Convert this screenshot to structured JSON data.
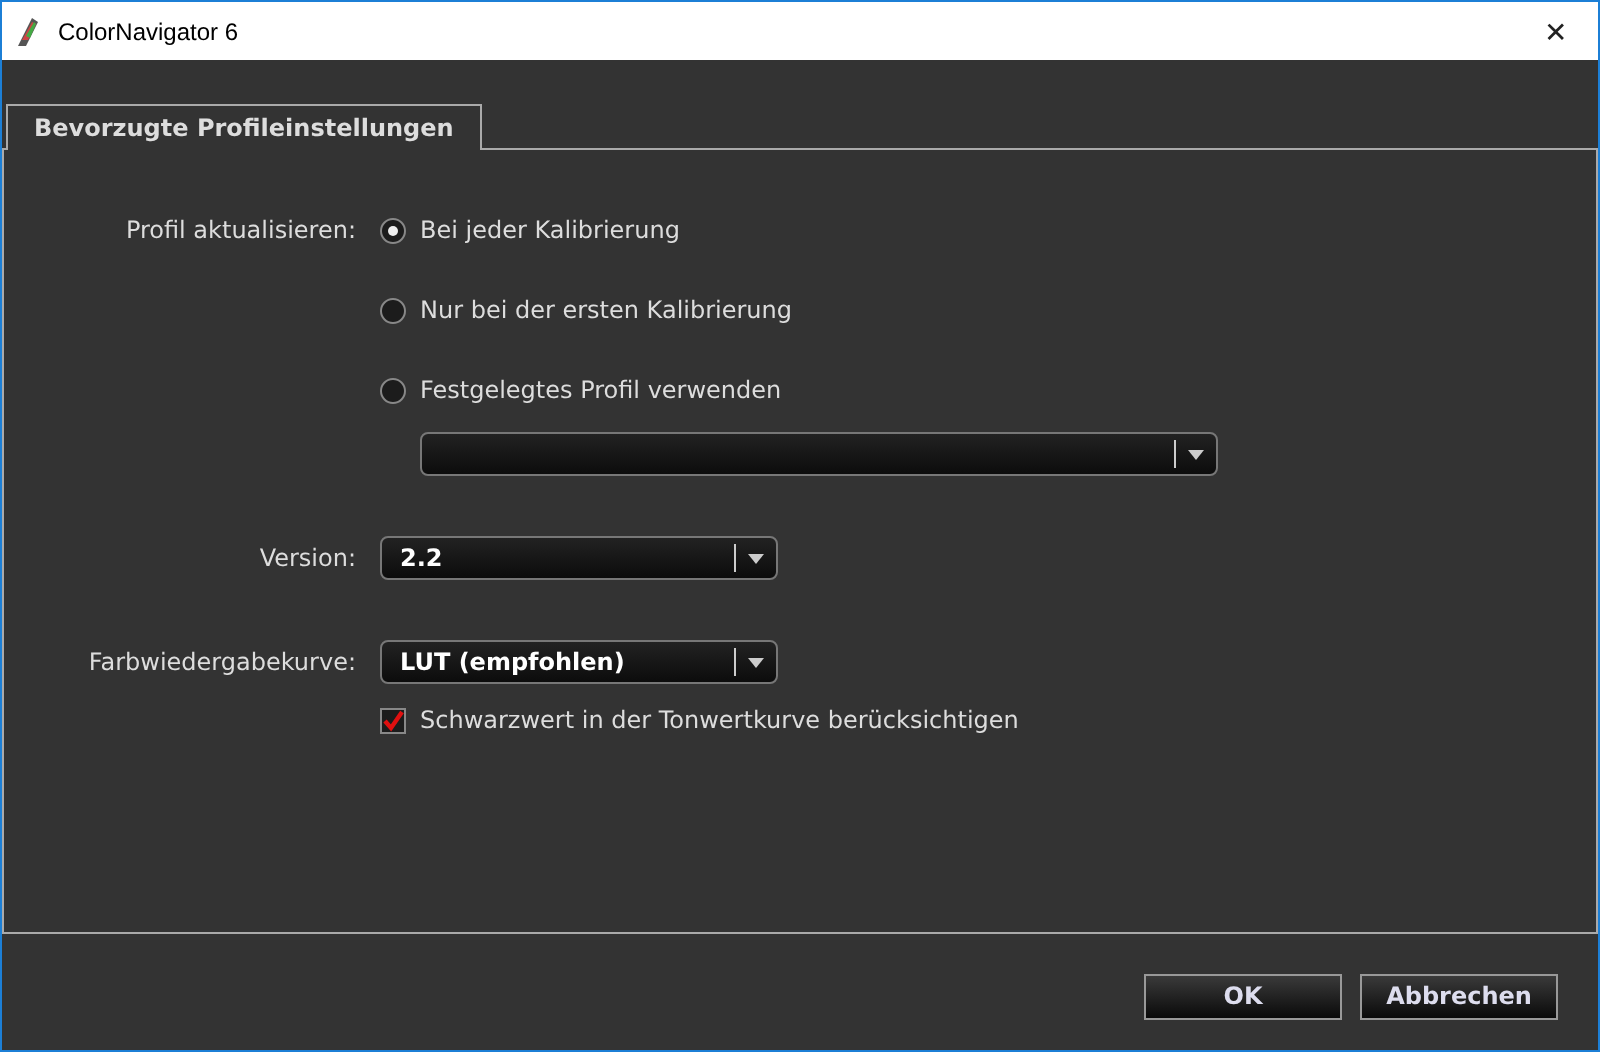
{
  "window": {
    "title": "ColorNavigator 6",
    "close": "✕"
  },
  "tabs": [
    {
      "label": "Bevorzugte Profileinstellungen",
      "selected": true
    }
  ],
  "profile_update": {
    "label": "Profil aktualisieren:",
    "options": [
      {
        "label": "Bei jeder Kalibrierung",
        "selected": true
      },
      {
        "label": "Nur bei der ersten Kalibrierung",
        "selected": false
      },
      {
        "label": "Festgelegtes Profil verwenden",
        "selected": false
      }
    ]
  },
  "version": {
    "label": "Version:",
    "value": "2.2"
  },
  "curve": {
    "label": "Farbwiedergabekurve:",
    "value": "LUT (empfohlen)",
    "checkbox": {
      "label": "Schwarzwert in der Tonwertkurve berücksichtigen",
      "checked": true
    }
  },
  "buttons": [
    "OK",
    "Abbrechen"
  ]
}
